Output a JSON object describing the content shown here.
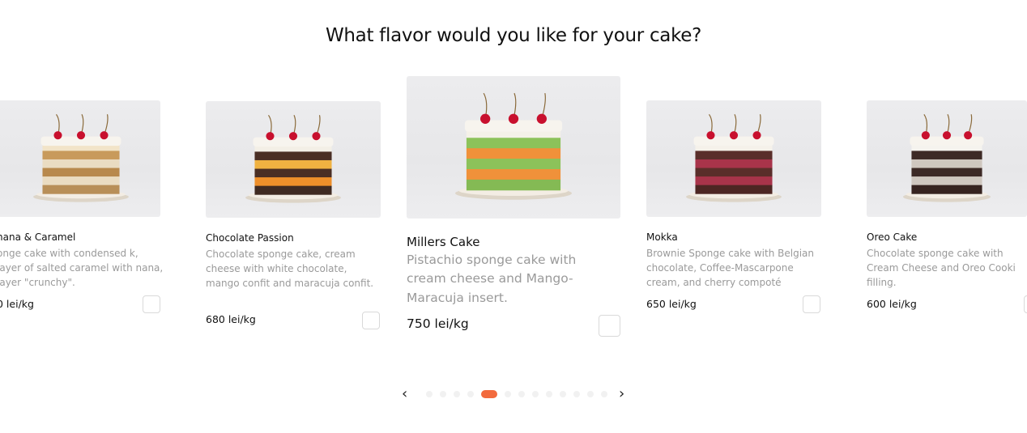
{
  "page": {
    "title": "What flavor would you like for your cake?"
  },
  "cards": [
    {
      "name": "nana & Caramel",
      "desc": "onge cake with condensed k, layer of salted caramel with nana, layer \"crunchy\".",
      "price": "0 lei/kg",
      "layers": [
        "#f2e4c8",
        "#c89a5b",
        "#eadcc2",
        "#b8894d",
        "#eadcc2",
        "#b88f58"
      ]
    },
    {
      "name": "Chocolate Passion",
      "desc": "Chocolate sponge cake, cream cheese with white chocolate, mango confit and maracuja confit.",
      "price": "680 lei/kg",
      "layers": [
        "#f3efe6",
        "#4a2e24",
        "#f0b241",
        "#4a2e24",
        "#ee8f2a",
        "#3f2a22"
      ]
    },
    {
      "name": "Millers Cake",
      "desc": "Pistachio sponge cake with cream cheese and Mango-Maracuja insert.",
      "price": "750 lei/kg",
      "layers": [
        "#f4f1e8",
        "#8cc25a",
        "#f0913a",
        "#8cc25a",
        "#f0913a",
        "#84ba54"
      ]
    },
    {
      "name": "Mokka",
      "desc": "Brownie Sponge cake with Belgian chocolate, Coffee-Mascarpone cream, and cherry compoté",
      "price": "650 lei/kg",
      "layers": [
        "#f5f1ea",
        "#5a2e2a",
        "#a8344a",
        "#5a2e2a",
        "#a8344a",
        "#4d2623"
      ]
    },
    {
      "name": "Oreo Cake",
      "desc": "Chocolate sponge cake with Cream Cheese and Oreo Cooki filling.",
      "price": "600 lei/kg",
      "layers": [
        "#f5f3ee",
        "#3d2a26",
        "#cfc7bf",
        "#3d2a26",
        "#cfc7bf",
        "#36231f"
      ]
    }
  ],
  "pager": {
    "prev": "‹",
    "next": "›",
    "total_dots": 13,
    "active_index": 4
  },
  "colors": {
    "accent": "#f26a3d",
    "cherry": "#c8102e",
    "text_muted": "#9a9a9a"
  },
  "icons": {
    "prev": "chevron-left-icon",
    "next": "chevron-right-icon"
  }
}
